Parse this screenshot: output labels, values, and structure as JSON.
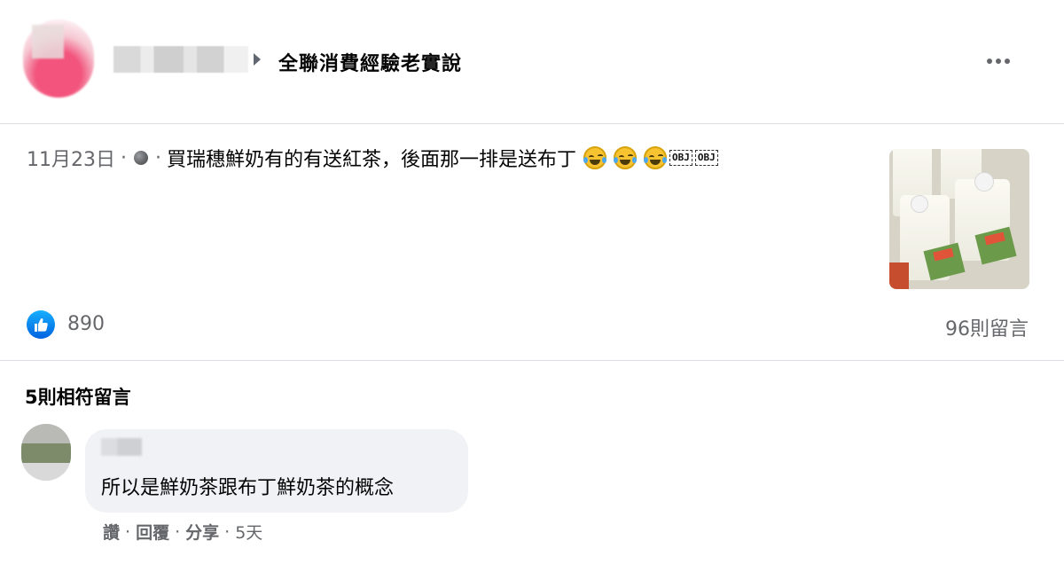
{
  "header": {
    "group_name": "全聯消費經驗老實說"
  },
  "post": {
    "date": "11月23日",
    "separator": "·",
    "text": "買瑞穗鮮奶有的有送紅茶，後面那一排是送布丁",
    "emoji_count": 3,
    "obj_placeholders": [
      "OBJ",
      "OBJ"
    ],
    "like_count": "890",
    "comment_count": "96則留言"
  },
  "comments_section": {
    "title": "5則相符留言",
    "comments": [
      {
        "text": "所以是鮮奶茶跟布丁鮮奶茶的概念",
        "actions": {
          "like": "讚",
          "reply": "回覆",
          "share": "分享",
          "time": "5天"
        }
      }
    ]
  },
  "colors": {
    "like_blue": "#1877f2",
    "secondary_text": "#65676b",
    "bubble_bg": "#f0f2f5"
  },
  "icons": [
    "caret-right-icon",
    "more-icon",
    "globe-icon",
    "laugh-cry-emoji-icon",
    "like-icon"
  ]
}
